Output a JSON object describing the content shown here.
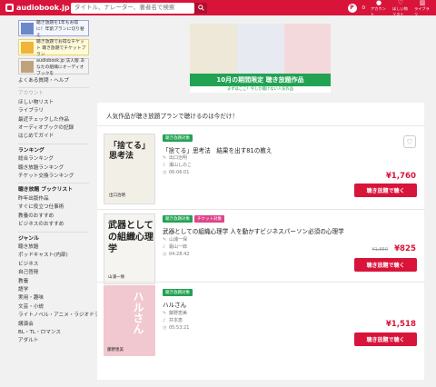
{
  "header": {
    "logo": "audiobook.jp",
    "search_placeholder": "タイトル、ナレーター、著者名で検索",
    "coin_count": "0",
    "account_label": "アカウント",
    "wishlist_label": "ほしい物リスト",
    "library_label": "ライブラリ"
  },
  "sidebar": {
    "promo1": "聴き放題を1年もお得に！年割プランに切り替え",
    "promo2": "聴き放題でお得なチケット 聴き放題でチケットプラン",
    "promo3": "audiobook.jp 法人版 あなたの組織にオーディオブックを",
    "faq": "よくある質問・ヘルプ",
    "account_grey": "アカウント",
    "account_links": [
      "ほしい物リスト",
      "ライブラリ",
      "最近チェックした作品",
      "オーディオブックの記録",
      "はじめてガイド"
    ],
    "ranking_head": "ランキング",
    "ranking_links": [
      "総合ランキング",
      "聴き放題ランキング",
      "チケット交換ランキング"
    ],
    "playlist_head": "聴き放題 ブックリスト",
    "playlist_links": [
      "昨年出版作品",
      "すぐに役立つ仕事術",
      "教養のおすすめ",
      "ビジネスのおすすめ"
    ],
    "genre_head": "ジャンル",
    "genre_links": [
      "聴き放題",
      "ポッドキャスト(内部)",
      "ビジネス",
      "自己啓発",
      "教養",
      "語学",
      "実用・趣味",
      "文芸・小説",
      "ライトノベル・アニメ・ラジオドラマ",
      "講演会",
      "BL・TL・ロマンス",
      "アダルト"
    ]
  },
  "banner": {
    "main_text": "10月の期間限定 聴き放題作品",
    "sub_text": "まずはここ！今しか聴けない人気作品"
  },
  "main": {
    "heading": "人気作品が聴き放題プランで聴けるのは今だけ！",
    "items": [
      {
        "tags": [
          "聴き放題対象"
        ],
        "title": "「捨てる」思考法　結果を出す81の教え",
        "author": "出口治明",
        "narrator": "瀬山しのこ",
        "duration": "06:06:01",
        "price": "¥1,760",
        "old_price": "",
        "button": "聴き放題で聴く",
        "cover_text": "「捨てる」思考法",
        "cover_author": "出口治明"
      },
      {
        "tags": [
          "聴き放題対象",
          "チケット対象"
        ],
        "title": "武器としての組織心理学 人を動かすビジネスパーソン必須の心理学",
        "author": "山浦一保",
        "narrator": "霜山一郎",
        "duration": "04:28:42",
        "price": "¥825",
        "old_price": "¥1,650",
        "button": "聴き放題で聴く",
        "cover_text": "武器としての組織心理学",
        "cover_author": "山浦一保"
      },
      {
        "tags": [
          "聴き放題対象"
        ],
        "title": "ハルさん",
        "author": "藤野恵美",
        "narrator": "井本恵",
        "duration": "05:53:21",
        "price": "¥1,518",
        "old_price": "",
        "button": "聴き放題で聴く",
        "cover_text": "ハルさん",
        "cover_author": "藤野恵美"
      }
    ]
  },
  "colors": {
    "brand": "#d8143a",
    "green": "#22a253",
    "pink": "#e0458a"
  }
}
